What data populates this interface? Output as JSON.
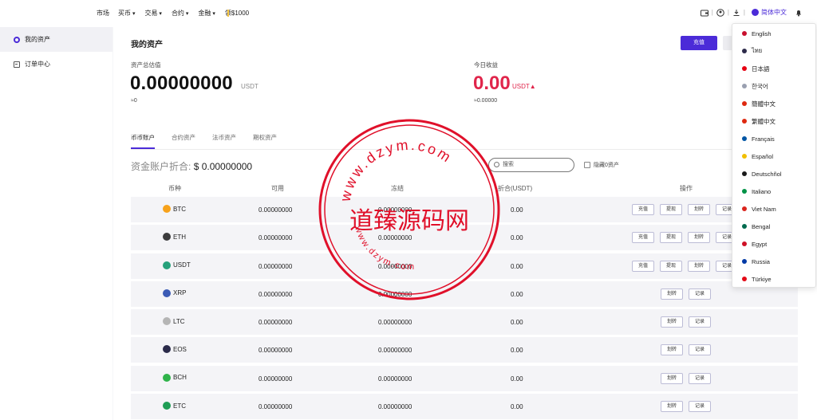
{
  "nav": {
    "market": "市场",
    "buy": "买币",
    "trade": "交易",
    "contract": "合约",
    "finance": "金融",
    "gift": "领$1000",
    "lang": "简体中文"
  },
  "sidebar": {
    "items": [
      {
        "label": "我的资产"
      },
      {
        "label": "订单中心"
      }
    ]
  },
  "header": {
    "title": "我的资产",
    "deposit": "充值"
  },
  "summary": {
    "total_label": "资产总估值",
    "total_value": "0.00000000",
    "total_unit": "USDT",
    "total_approx": "≈0",
    "today_label": "今日收益",
    "today_value": "0.00",
    "today_unit": "USDT▲",
    "today_approx": "≈0.00000"
  },
  "tabs": [
    "币币账户",
    "合约资产",
    "法币资产",
    "期权资产"
  ],
  "conversion": {
    "label": "资金账户折合:",
    "value": "$ 0.00000000"
  },
  "search": {
    "placeholder": "搜索"
  },
  "hide_zero": "隐藏0资产",
  "table": {
    "headers": [
      "币种",
      "可用",
      "冻结",
      "折合(USDT)",
      "操作"
    ],
    "rows": [
      {
        "coin": "BTC",
        "color": "#f7a21b",
        "available": "0.00000000",
        "frozen": "0.00000000",
        "usdt": "0.00",
        "actions": [
          "充值",
          "提现",
          "划转",
          "记录"
        ]
      },
      {
        "coin": "ETH",
        "color": "#3c3c3d",
        "available": "0.00000000",
        "frozen": "0.00000000",
        "usdt": "0.00",
        "actions": [
          "充值",
          "提现",
          "划转",
          "记录"
        ]
      },
      {
        "coin": "USDT",
        "color": "#26a17b",
        "available": "0.00000000",
        "frozen": "0.00000000",
        "usdt": "0.00",
        "actions": [
          "充值",
          "提现",
          "划转",
          "记录"
        ]
      },
      {
        "coin": "XRP",
        "color": "#3b5bb5",
        "available": "0.00000000",
        "frozen": "0.00000000",
        "usdt": "0.00",
        "actions": [
          "划转",
          "记录"
        ]
      },
      {
        "coin": "LTC",
        "color": "#b5b5b5",
        "available": "0.00000000",
        "frozen": "0.00000000",
        "usdt": "0.00",
        "actions": [
          "划转",
          "记录"
        ]
      },
      {
        "coin": "EOS",
        "color": "#2a2a4a",
        "available": "0.00000000",
        "frozen": "0.00000000",
        "usdt": "0.00",
        "actions": [
          "划转",
          "记录"
        ]
      },
      {
        "coin": "BCH",
        "color": "#2fb34a",
        "available": "0.00000000",
        "frozen": "0.00000000",
        "usdt": "0.00",
        "actions": [
          "划转",
          "记录"
        ]
      },
      {
        "coin": "ETC",
        "color": "#1f9d55",
        "available": "0.00000000",
        "frozen": "0.00000000",
        "usdt": "0.00",
        "actions": [
          "划转",
          "记录"
        ]
      }
    ]
  },
  "languages": [
    {
      "label": "English",
      "color": "#c8102e"
    },
    {
      "label": "ไทย",
      "color": "#2d2a4a"
    },
    {
      "label": "日本語",
      "color": "#e60012"
    },
    {
      "label": "한국어",
      "color": "#9aa0b0"
    },
    {
      "label": "簡體中文",
      "color": "#de2910"
    },
    {
      "label": "繁體中文",
      "color": "#de2910"
    },
    {
      "label": "Français",
      "color": "#0055a4"
    },
    {
      "label": "Español",
      "color": "#f1bf00"
    },
    {
      "label": "Deutschñol",
      "color": "#1a1a1a"
    },
    {
      "label": "Italiano",
      "color": "#009246"
    },
    {
      "label": "Viet Nam",
      "color": "#da251d"
    },
    {
      "label": "Bengal",
      "color": "#006a4e"
    },
    {
      "label": "Egypt",
      "color": "#ce1126"
    },
    {
      "label": "Russia",
      "color": "#0039a6"
    },
    {
      "label": "Türkiye",
      "color": "#e30a17"
    }
  ],
  "watermark": {
    "center_text": "道臻源码网",
    "ring_text": "www.dzym.com"
  },
  "colors": {
    "accent": "#4b2bd8",
    "positive": "#e0254b",
    "stamp": "#e0102a"
  }
}
